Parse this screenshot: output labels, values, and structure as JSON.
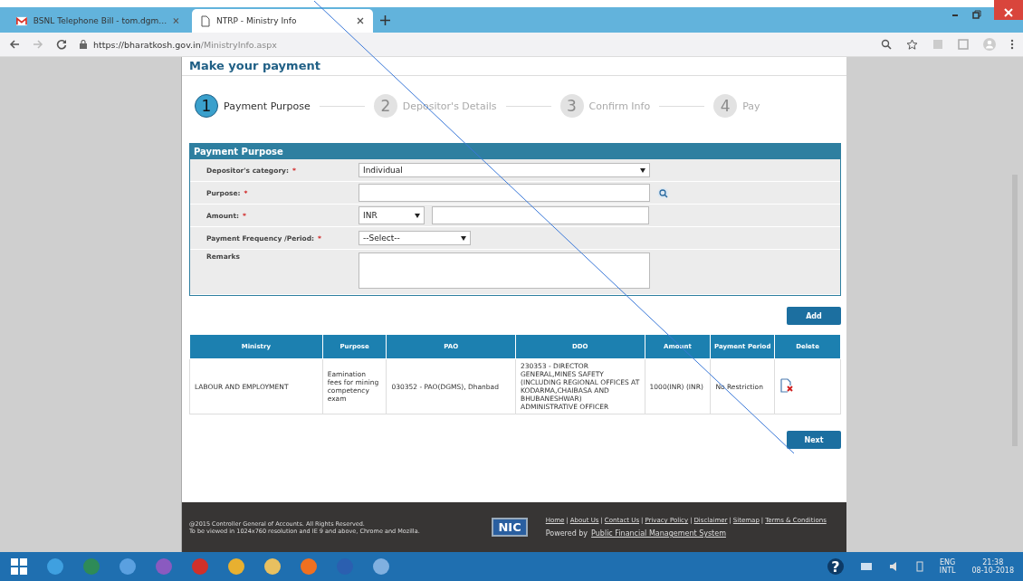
{
  "browser": {
    "tabs": [
      {
        "title": "BSNL Telephone Bill - tom.dgm…",
        "kind": "mail",
        "selected": false
      },
      {
        "title": "NTRP - Ministry Info",
        "kind": "page",
        "selected": true
      }
    ],
    "url_host": "https://bharatkosh.gov.in",
    "url_path": "/MinistryInfo.aspx"
  },
  "page": {
    "title": "Make your payment",
    "steps": [
      {
        "number": "1",
        "label": "Payment Purpose",
        "selected": true
      },
      {
        "number": "2",
        "label": "Depositor's Details",
        "selected": false
      },
      {
        "number": "3",
        "label": "Confirm Info",
        "selected": false
      },
      {
        "number": "4",
        "label": "Pay",
        "selected": false
      }
    ],
    "panel_title": "Payment Purpose",
    "fields": [
      {
        "kind": "select",
        "label": "Depositor's category:",
        "required": "*",
        "value": "Individual"
      },
      {
        "kind": "search",
        "label": "Purpose:",
        "required": "*"
      },
      {
        "kind": "amount",
        "label": "Amount:",
        "required": "*",
        "currency": "INR"
      },
      {
        "kind": "shortselect",
        "label": "Payment Frequency /Period:",
        "required": "*",
        "value": "--Select--"
      },
      {
        "kind": "textarea",
        "label": "Remarks"
      }
    ],
    "add_button": "Add",
    "table": {
      "columns": [
        "Ministry",
        "Purpose",
        "PAO",
        "DDO",
        "Amount",
        "Payment Period",
        "Delete"
      ],
      "rows": [
        [
          "LABOUR AND EMPLOYMENT",
          "Eamination fees for mining competency exam",
          "030352 - PAO(DGMS), Dhanbad",
          "230353 - DIRECTOR GENERAL,MINES SAFETY (INCLUDING REGIONAL OFFICES AT KODARMA,CHAIBASA AND BHUBANESHWAR) ADMINISTRATIVE OFFICER",
          "1000(INR) (INR)",
          "No Restriction"
        ]
      ]
    },
    "next_button": "Next",
    "footer": {
      "copyright": "@2015 Controller General of Accounts. All Rights Reserved.",
      "notice": "To be viewed in 1024x760 resolution and IE 9 and above, Chrome and Mozilla.",
      "logo": "NIC",
      "links": [
        "Home",
        "About Us",
        "Contact Us",
        "Privacy Policy",
        "Disclaimer",
        "Sitemap",
        "Terms & Conditions"
      ],
      "separator": "|",
      "powered_label": "Powered by",
      "powered_link": "Public Financial Management System"
    }
  },
  "taskbar": {
    "help": "?",
    "language": "ENG",
    "layout": "INTL",
    "time": "21:38",
    "date": "08-10-2018"
  }
}
